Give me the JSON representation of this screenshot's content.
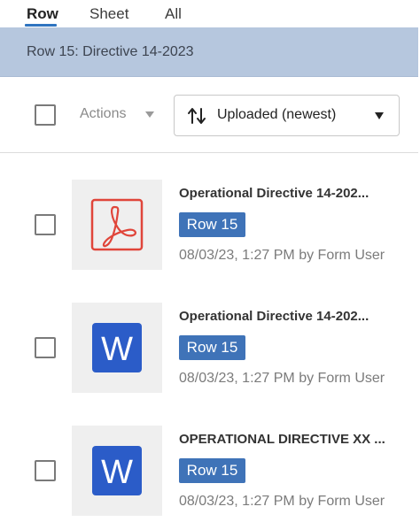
{
  "tabs": [
    {
      "label": "Row",
      "active": true
    },
    {
      "label": "Sheet",
      "active": false
    },
    {
      "label": "All",
      "active": false
    }
  ],
  "banner": {
    "text": "Row 15: Directive 14-2023"
  },
  "toolbar": {
    "actions_label": "Actions",
    "sort": {
      "label": "Uploaded (newest)",
      "icon": "sort-arrows-icon"
    }
  },
  "colors": {
    "accent": "#2f74c0",
    "badge": "#3f73b8",
    "banner": "#b6c7de",
    "pdf_red": "#e0453a",
    "word_blue": "#2b5cc8"
  },
  "items": [
    {
      "title": "Operational Directive 14-202...",
      "badge": "Row 15",
      "meta": "08/03/23, 1:27 PM by Form User",
      "icon": "pdf-icon"
    },
    {
      "title": "Operational Directive 14-202...",
      "badge": "Row 15",
      "meta": "08/03/23, 1:27 PM by Form User",
      "icon": "word-icon"
    },
    {
      "title": "OPERATIONAL DIRECTIVE XX ...",
      "badge": "Row 15",
      "meta": "08/03/23, 1:27 PM by Form User",
      "icon": "word-icon"
    }
  ]
}
